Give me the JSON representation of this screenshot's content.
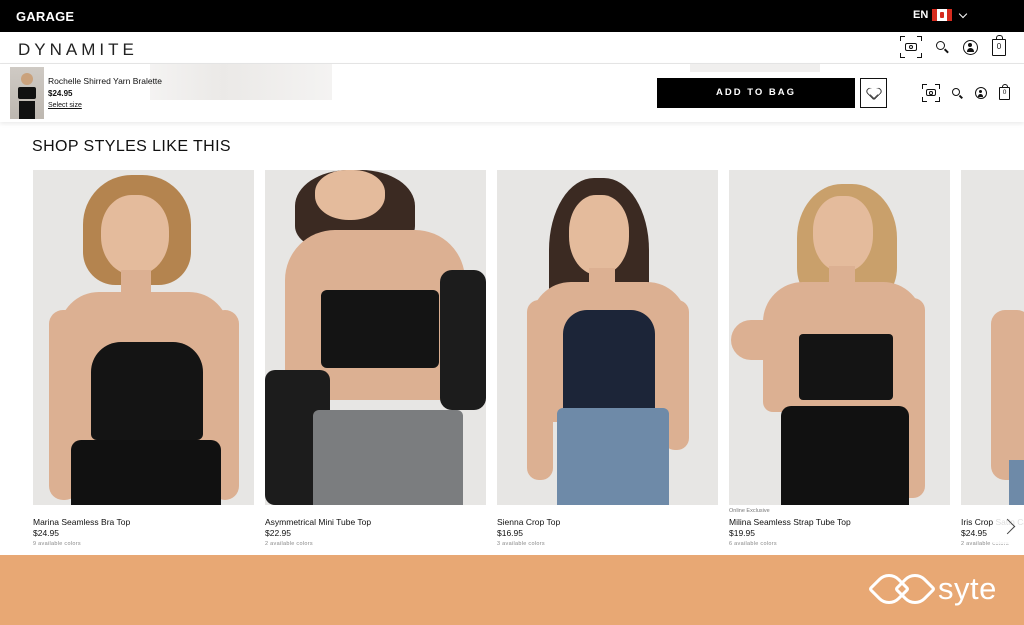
{
  "topbar": {
    "store": "GARAGE",
    "language": "EN"
  },
  "header": {
    "brand": "DYNAMITE",
    "cart_count": "0"
  },
  "sticky": {
    "product_name": "Rochelle Shirred Yarn Bralette",
    "price": "$24.95",
    "select_size": "Select size",
    "add_to_bag": "ADD TO BAG",
    "cart_count": "0"
  },
  "section": {
    "title": "SHOP STYLES LIKE THIS"
  },
  "products": [
    {
      "name": "Marina Seamless Bra Top",
      "price": "$24.95",
      "colors": "9 available colors",
      "badge": ""
    },
    {
      "name": "Asymmetrical Mini Tube Top",
      "price": "$22.95",
      "colors": "2 available colors",
      "badge": ""
    },
    {
      "name": "Sienna Crop Top",
      "price": "$16.95",
      "colors": "3 available colors",
      "badge": ""
    },
    {
      "name": "Milina Seamless Strap Tube Top",
      "price": "$19.95",
      "colors": "6 available colors",
      "badge": "Online Exclusive"
    },
    {
      "name": "Iris Crop Satin Ca",
      "price": "$24.95",
      "colors": "2 available colors",
      "badge": ""
    }
  ],
  "footer": {
    "logo_text": "syte"
  },
  "colors": {
    "footer_bg": "#e8a874",
    "button_bg": "#000000",
    "topbar_bg": "#000000"
  }
}
